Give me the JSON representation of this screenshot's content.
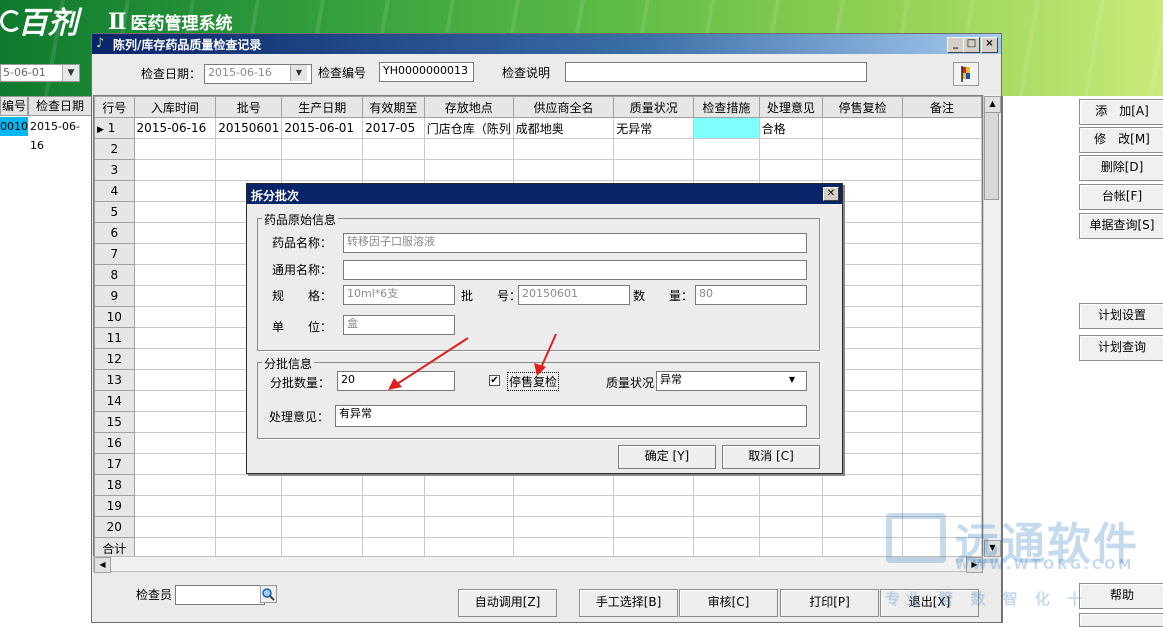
{
  "app": {
    "logo": "百剂",
    "version": "Ⅱ",
    "title": "医药管理系统"
  },
  "background_window": {
    "date_value": "5-06-01",
    "columns": [
      "编号",
      "检查日期"
    ],
    "row": [
      "0010",
      "2015-06-16"
    ]
  },
  "window": {
    "title": "陈列/库存药品质量检查记录",
    "controls": [
      "_",
      "□",
      "×"
    ]
  },
  "form": {
    "check_date_label": "检查日期：",
    "check_date_value": "2015-06-16",
    "check_no_label": "检查编号",
    "check_no_value": "YH0000000013",
    "check_desc_label": "检查说明",
    "check_desc_value": ""
  },
  "grid": {
    "headers": [
      "行号",
      "入库时间",
      "批号",
      "生产日期",
      "有效期至",
      "存放地点",
      "供应商全名",
      "质量状况",
      "检查措施",
      "处理意见",
      "停售复检",
      "备注"
    ],
    "row1": [
      "2015-06-16",
      "20150601",
      "2015-06-01",
      "2017-05",
      "门店仓库（陈列",
      "成都地奥",
      "无异常",
      "",
      "合格",
      "",
      ""
    ],
    "row_numbers": [
      "1",
      "2",
      "3",
      "4",
      "5",
      "6",
      "7",
      "8",
      "9",
      "10",
      "11",
      "12",
      "13",
      "14",
      "15",
      "16",
      "17",
      "18",
      "19",
      "20"
    ],
    "total_label": "合计"
  },
  "bottom": {
    "inspector_label": "检查员",
    "inspector_value": "",
    "buttons": [
      "自动调用[Z]",
      "手工选择[B]",
      "审核[C]",
      "打印[P]",
      "退出[X]"
    ]
  },
  "right_buttons": [
    "添　加[A]",
    "修　改[M]",
    "删除[D]",
    "台帐[F]",
    "单据查询[S]",
    "计划设置",
    "计划查询",
    "帮助"
  ],
  "dialog": {
    "title": "拆分批次",
    "group1_title": "药品原始信息",
    "drug_name_label": "药品名称：",
    "drug_name_value": "转移因子口服溶液",
    "common_name_label": "通用名称：",
    "common_name_value": "",
    "spec_label": "规　　格：",
    "spec_value": "10ml*6支",
    "batch_label": "批　　号：",
    "batch_value": "20150601",
    "qty_label": "数　　量：",
    "qty_value": "80",
    "unit_label": "单　　位：",
    "unit_value": "盒",
    "group2_title": "分批信息",
    "split_qty_label": "分批数量：",
    "split_qty_value": "20",
    "stop_sale_label": "停售复检",
    "stop_sale_checked": true,
    "quality_label": "质量状况",
    "quality_value": "异常",
    "opinion_label": "处理意见：",
    "opinion_value": "有异常",
    "ok_button": "确定 [Y]",
    "cancel_button": "取消 [C]"
  },
  "watermark": {
    "brand": "远通软件",
    "url": "WWW.WTORG.COM",
    "slogan": "专业 管 数 智 化 十"
  },
  "colors": {
    "title_bar": "#0a246a",
    "selected_cell": "#80ffff",
    "arrow": "#e02020"
  }
}
